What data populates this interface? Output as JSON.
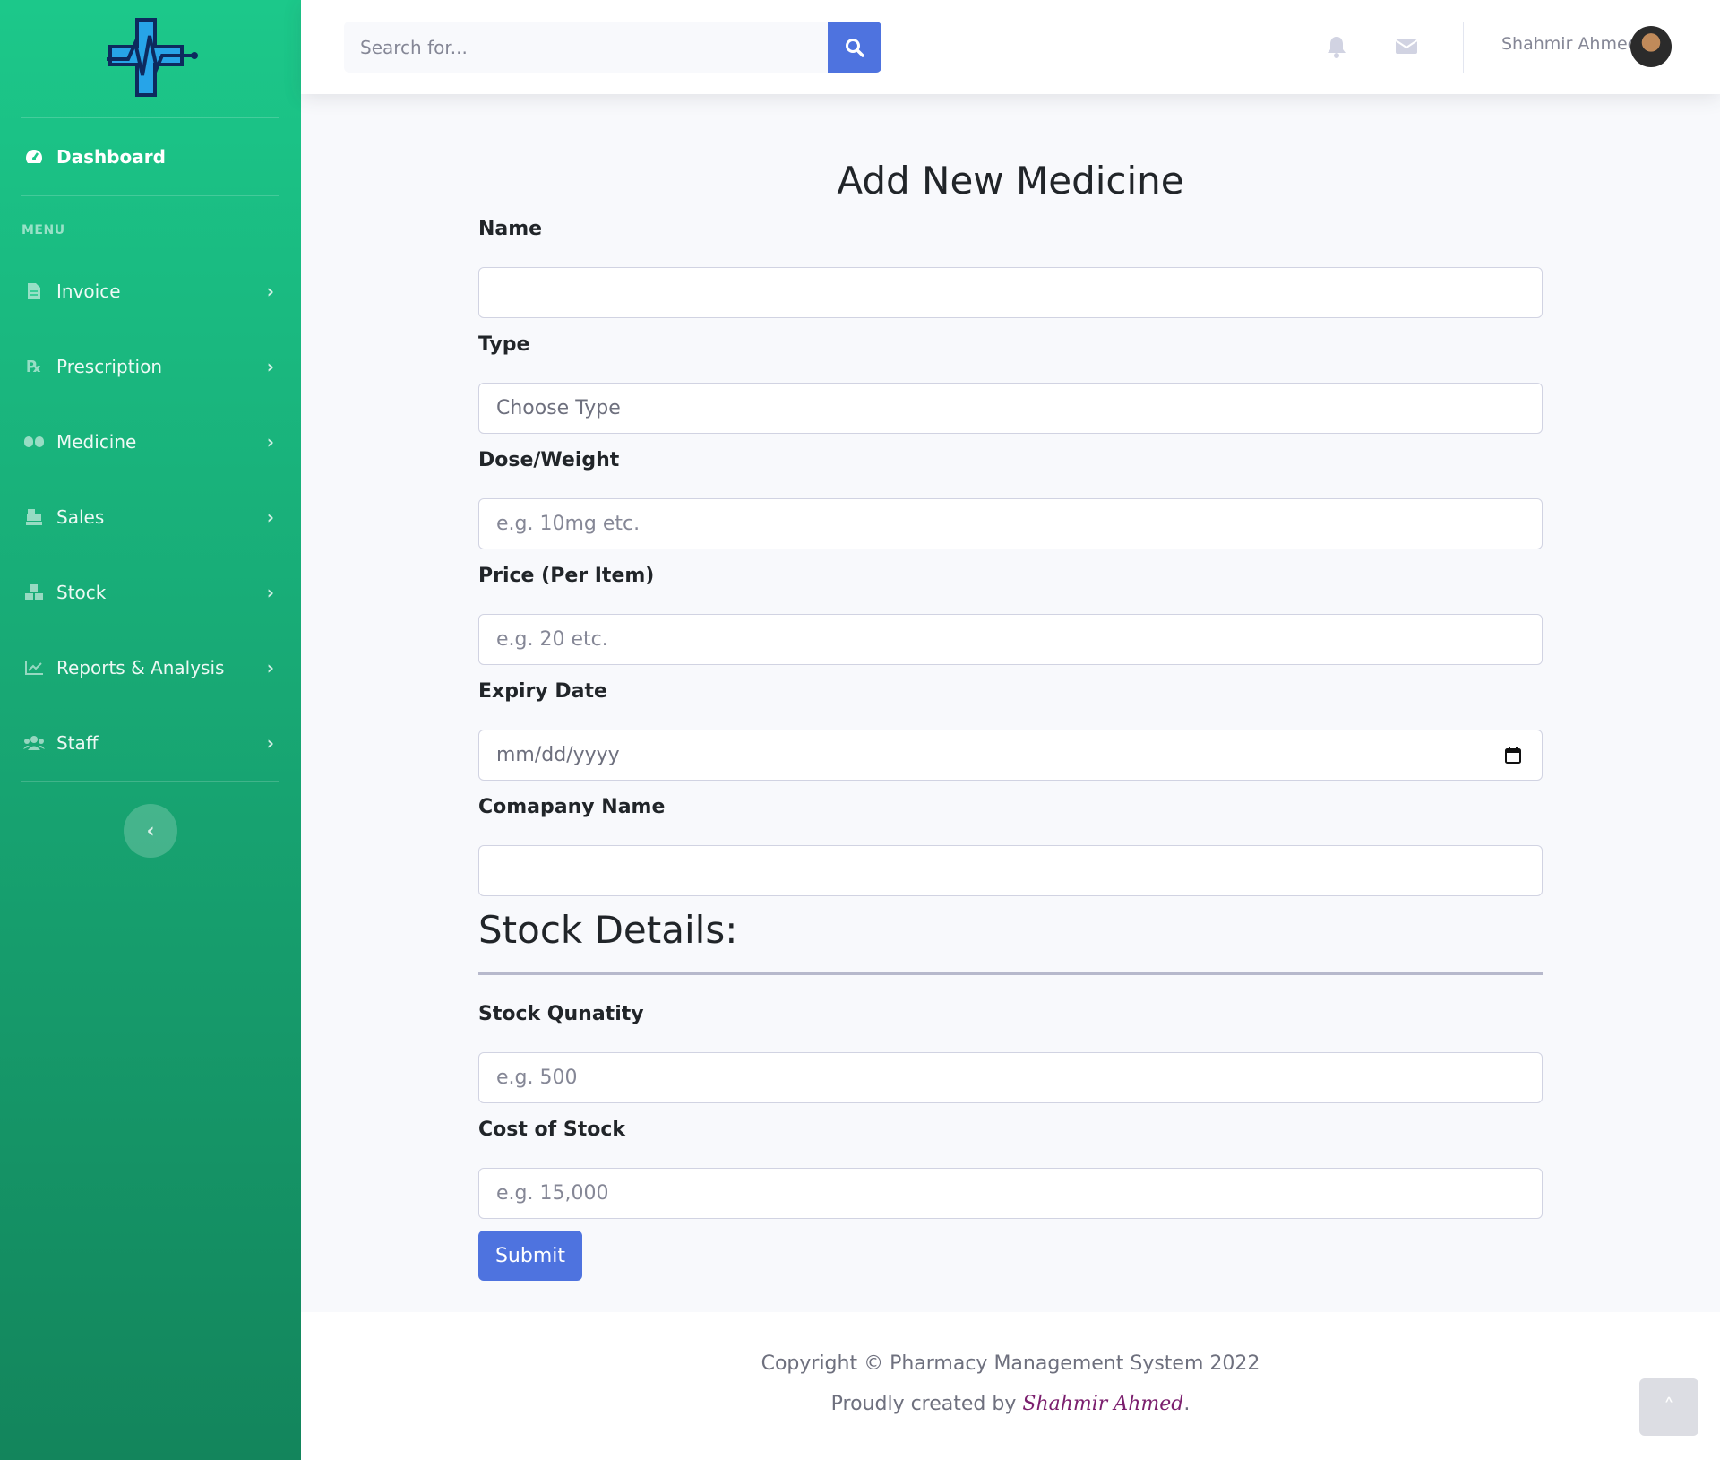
{
  "sidebar": {
    "dashboard_label": "Dashboard",
    "menu_heading": "MENU",
    "items": [
      {
        "label": "Invoice",
        "icon": "file-icon"
      },
      {
        "label": "Prescription",
        "icon": "prescription-icon"
      },
      {
        "label": "Medicine",
        "icon": "pills-icon"
      },
      {
        "label": "Sales",
        "icon": "cash-register-icon"
      },
      {
        "label": "Stock",
        "icon": "boxes-icon"
      },
      {
        "label": "Reports & Analysis",
        "icon": "chart-line-icon"
      },
      {
        "label": "Staff",
        "icon": "users-icon"
      }
    ]
  },
  "topbar": {
    "search_placeholder": "Search for...",
    "user_name": "Shahmir Ahmed"
  },
  "form": {
    "title": "Add New Medicine",
    "name_label": "Name",
    "type_label": "Type",
    "type_value": "Choose Type",
    "dose_label": "Dose/Weight",
    "dose_placeholder": "e.g. 10mg etc.",
    "price_label": "Price (Per Item)",
    "price_placeholder": "e.g. 20 etc.",
    "expiry_label": "Expiry Date",
    "expiry_placeholder": "mm/dd/yyyy",
    "company_label": "Comapany Name",
    "stock_section_title": "Stock Details:",
    "stock_qty_label": "Stock Qunatity",
    "stock_qty_placeholder": "e.g. 500",
    "stock_cost_label": "Cost of Stock",
    "stock_cost_placeholder": "e.g. 15,000",
    "submit_label": "Submit"
  },
  "footer": {
    "copyright": "Copyright © Pharmacy Management System 2022",
    "credit_prefix": "Proudly created by ",
    "credit_name": "Shahmir Ahmed",
    "credit_suffix": "."
  },
  "colors": {
    "sidebar_top": "#1cc88a",
    "sidebar_bottom": "#13855c",
    "primary": "#4e73df"
  }
}
